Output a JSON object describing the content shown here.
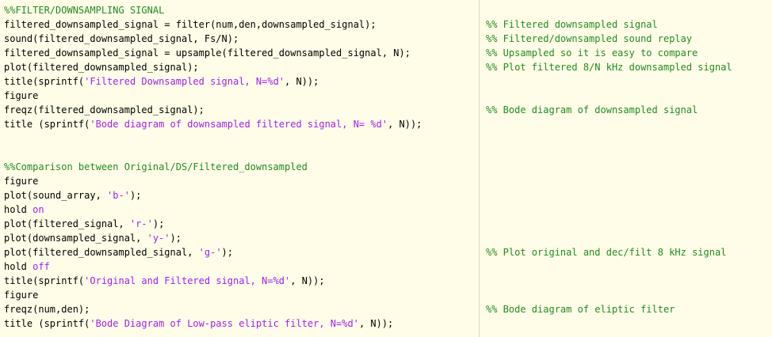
{
  "colors": {
    "background": "#fffde7",
    "plain": "#000000",
    "comment": "#228b22",
    "string": "#a020f0",
    "keyword": "#a020f0",
    "margin_line": "#d9d6c4"
  },
  "lines": [
    {
      "code": [
        {
          "t": "comment",
          "s": "%%FILTER/DOWNSAMPLING SIGNAL"
        }
      ],
      "comment": ""
    },
    {
      "code": [
        {
          "t": "plain",
          "s": "filtered_downsampled_signal = filter(num,den,downsampled_signal);"
        }
      ],
      "comment": "%% Filtered downsampled signal"
    },
    {
      "code": [
        {
          "t": "plain",
          "s": "sound(filtered_downsampled_signal, Fs/N);"
        }
      ],
      "comment": "%% Filtered/downsampled sound replay"
    },
    {
      "code": [
        {
          "t": "plain",
          "s": "filtered_downsampled_signal = upsample(filtered_downsampled_signal, N);"
        }
      ],
      "comment": "%% Upsampled so it is easy to compare"
    },
    {
      "code": [
        {
          "t": "plain",
          "s": "plot(filtered_downsampled_signal);"
        }
      ],
      "comment": "%% Plot filtered 8/N kHz downsampled signal"
    },
    {
      "code": [
        {
          "t": "plain",
          "s": "title(sprintf("
        },
        {
          "t": "string",
          "s": "'Filtered Downsampled signal, N=%d'"
        },
        {
          "t": "plain",
          "s": ", N));"
        }
      ],
      "comment": ""
    },
    {
      "code": [
        {
          "t": "plain",
          "s": "figure"
        }
      ],
      "comment": ""
    },
    {
      "code": [
        {
          "t": "plain",
          "s": "freqz(filtered_downsampled_signal);"
        }
      ],
      "comment": "%% Bode diagram of downsampled signal"
    },
    {
      "code": [
        {
          "t": "plain",
          "s": "title (sprintf("
        },
        {
          "t": "string",
          "s": "'Bode diagram of downsampled filtered signal, N= %d'"
        },
        {
          "t": "plain",
          "s": ", N));"
        }
      ],
      "comment": ""
    },
    {
      "code": [],
      "comment": ""
    },
    {
      "code": [],
      "comment": ""
    },
    {
      "code": [
        {
          "t": "comment",
          "s": "%%Comparison between Original/DS/Filtered_downsampled"
        }
      ],
      "comment": ""
    },
    {
      "code": [
        {
          "t": "plain",
          "s": "figure"
        }
      ],
      "comment": ""
    },
    {
      "code": [
        {
          "t": "plain",
          "s": "plot(sound_array, "
        },
        {
          "t": "string",
          "s": "'b-'"
        },
        {
          "t": "plain",
          "s": ");"
        }
      ],
      "comment": ""
    },
    {
      "code": [
        {
          "t": "plain",
          "s": "hold "
        },
        {
          "t": "keyword",
          "s": "on"
        }
      ],
      "comment": ""
    },
    {
      "code": [
        {
          "t": "plain",
          "s": "plot(filtered_signal, "
        },
        {
          "t": "string",
          "s": "'r-'"
        },
        {
          "t": "plain",
          "s": ");"
        }
      ],
      "comment": ""
    },
    {
      "code": [
        {
          "t": "plain",
          "s": "plot(downsampled_signal, "
        },
        {
          "t": "string",
          "s": "'y-'"
        },
        {
          "t": "plain",
          "s": ");"
        }
      ],
      "comment": ""
    },
    {
      "code": [
        {
          "t": "plain",
          "s": "plot(filtered_downsampled_signal, "
        },
        {
          "t": "string",
          "s": "'g-'"
        },
        {
          "t": "plain",
          "s": ");"
        }
      ],
      "comment": "%% Plot original and dec/filt 8 kHz signal"
    },
    {
      "code": [
        {
          "t": "plain",
          "s": "hold "
        },
        {
          "t": "keyword",
          "s": "off"
        }
      ],
      "comment": ""
    },
    {
      "code": [
        {
          "t": "plain",
          "s": "title(sprintf("
        },
        {
          "t": "string",
          "s": "'Original and Filtered signal, N=%d'"
        },
        {
          "t": "plain",
          "s": ", N));"
        }
      ],
      "comment": ""
    },
    {
      "code": [
        {
          "t": "plain",
          "s": "figure"
        }
      ],
      "comment": ""
    },
    {
      "code": [
        {
          "t": "plain",
          "s": "freqz(num,den);"
        }
      ],
      "comment": "%% Bode diagram of eliptic filter"
    },
    {
      "code": [
        {
          "t": "plain",
          "s": "title (sprintf("
        },
        {
          "t": "string",
          "s": "'Bode Diagram of Low-pass eliptic filter, N=%d'"
        },
        {
          "t": "plain",
          "s": ", N));"
        }
      ],
      "comment": ""
    }
  ]
}
